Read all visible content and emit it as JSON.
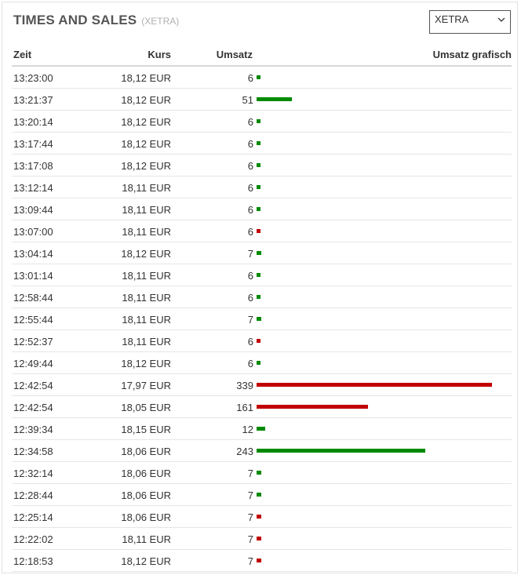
{
  "header": {
    "title": "TIMES AND SALES",
    "subtitle": "(XETRA)"
  },
  "exchange_select": {
    "selected": "XETRA",
    "icon": "chevron-down-icon"
  },
  "table": {
    "columns": [
      "Zeit",
      "Kurs",
      "Umsatz",
      "Umsatz grafisch"
    ],
    "max_volume": 339,
    "colors": {
      "up": "#008a00",
      "down": "#c00000"
    },
    "rows": [
      {
        "time": "13:23:00",
        "price": "18,12 EUR",
        "volume": "6",
        "vol": 6,
        "dir": "up"
      },
      {
        "time": "13:21:37",
        "price": "18,12 EUR",
        "volume": "51",
        "vol": 51,
        "dir": "up"
      },
      {
        "time": "13:20:14",
        "price": "18,12 EUR",
        "volume": "6",
        "vol": 6,
        "dir": "up"
      },
      {
        "time": "13:17:44",
        "price": "18,12 EUR",
        "volume": "6",
        "vol": 6,
        "dir": "up"
      },
      {
        "time": "13:17:08",
        "price": "18,12 EUR",
        "volume": "6",
        "vol": 6,
        "dir": "up"
      },
      {
        "time": "13:12:14",
        "price": "18,11 EUR",
        "volume": "6",
        "vol": 6,
        "dir": "up"
      },
      {
        "time": "13:09:44",
        "price": "18,11 EUR",
        "volume": "6",
        "vol": 6,
        "dir": "up"
      },
      {
        "time": "13:07:00",
        "price": "18,11 EUR",
        "volume": "6",
        "vol": 6,
        "dir": "down"
      },
      {
        "time": "13:04:14",
        "price": "18,12 EUR",
        "volume": "7",
        "vol": 7,
        "dir": "up"
      },
      {
        "time": "13:01:14",
        "price": "18,11 EUR",
        "volume": "6",
        "vol": 6,
        "dir": "up"
      },
      {
        "time": "12:58:44",
        "price": "18,11 EUR",
        "volume": "6",
        "vol": 6,
        "dir": "up"
      },
      {
        "time": "12:55:44",
        "price": "18,11 EUR",
        "volume": "7",
        "vol": 7,
        "dir": "up"
      },
      {
        "time": "12:52:37",
        "price": "18,11 EUR",
        "volume": "6",
        "vol": 6,
        "dir": "down"
      },
      {
        "time": "12:49:44",
        "price": "18,12 EUR",
        "volume": "6",
        "vol": 6,
        "dir": "up"
      },
      {
        "time": "12:42:54",
        "price": "17,97 EUR",
        "volume": "339",
        "vol": 339,
        "dir": "down"
      },
      {
        "time": "12:42:54",
        "price": "18,05 EUR",
        "volume": "161",
        "vol": 161,
        "dir": "down"
      },
      {
        "time": "12:39:34",
        "price": "18,15 EUR",
        "volume": "12",
        "vol": 12,
        "dir": "up"
      },
      {
        "time": "12:34:58",
        "price": "18,06 EUR",
        "volume": "243",
        "vol": 243,
        "dir": "up"
      },
      {
        "time": "12:32:14",
        "price": "18,06 EUR",
        "volume": "7",
        "vol": 7,
        "dir": "up"
      },
      {
        "time": "12:28:44",
        "price": "18,06 EUR",
        "volume": "7",
        "vol": 7,
        "dir": "up"
      },
      {
        "time": "12:25:14",
        "price": "18,06 EUR",
        "volume": "7",
        "vol": 7,
        "dir": "down"
      },
      {
        "time": "12:22:02",
        "price": "18,11 EUR",
        "volume": "7",
        "vol": 7,
        "dir": "down"
      },
      {
        "time": "12:18:53",
        "price": "18,12 EUR",
        "volume": "7",
        "vol": 7,
        "dir": "down"
      }
    ]
  }
}
